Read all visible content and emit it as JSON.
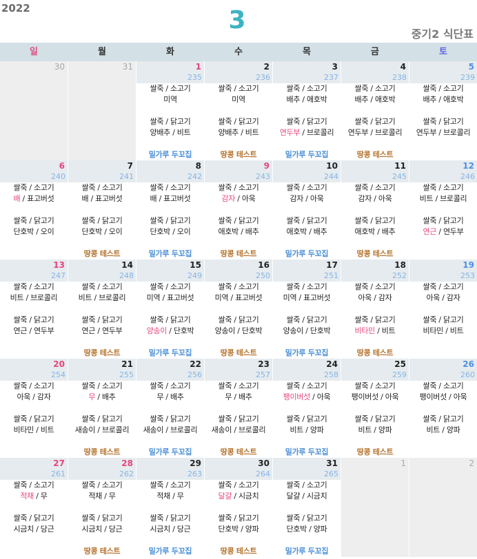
{
  "header": {
    "year": "2022",
    "month": "3",
    "title": "중기2 식단표"
  },
  "colors": {
    "month": "#3db3c4",
    "holiday": "#e8457d",
    "saturday_date": "#4f8fe3",
    "new_food": "#e8457d",
    "count": "#86b4e6",
    "muted_date": "#a8a8a8"
  },
  "weekdays": [
    {
      "label": "일",
      "color": "#e24a84"
    },
    {
      "label": "월"
    },
    {
      "label": "화"
    },
    {
      "label": "수"
    },
    {
      "label": "목"
    },
    {
      "label": "금"
    },
    {
      "label": "토",
      "color": "#6366e0"
    }
  ],
  "weeks": [
    [
      {
        "day": 30,
        "muted": true
      },
      {
        "day": 31,
        "muted": true
      },
      {
        "day": 1,
        "count": 235,
        "red": true,
        "meals": [
          [
            "쌀죽 / 소고기",
            "미역"
          ],
          [
            "쌀죽 / 닭고기",
            "양배추 / 비트"
          ]
        ],
        "note": {
          "text": "밀가루 두꼬집",
          "color": "#4a8fd6"
        }
      },
      {
        "day": 2,
        "count": 236,
        "meals": [
          [
            "쌀죽 / 소고기",
            "미역"
          ],
          [
            "쌀죽 / 닭고기",
            "양배추 / 비트"
          ]
        ],
        "note": {
          "text": "땅콩 테스트",
          "color": "#b5732e"
        }
      },
      {
        "day": 3,
        "count": 237,
        "meals": [
          [
            "쌀죽 / 소고기",
            "배추 / 애호박"
          ],
          [
            "쌀죽 / 닭고기",
            {
              "new": "연두부",
              "rest": " / 브로콜리"
            }
          ]
        ],
        "note": {
          "text": "밀가루 두꼬집",
          "color": "#4a8fd6"
        }
      },
      {
        "day": 4,
        "count": 238,
        "meals": [
          [
            "쌀죽 / 소고기",
            "배추 / 애호박"
          ],
          [
            "쌀죽 / 닭고기",
            "연두부 / 브로콜리"
          ]
        ],
        "note": {
          "text": "땅콩 테스트",
          "color": "#b5732e"
        }
      },
      {
        "day": 5,
        "count": 239,
        "meals": [
          [
            "쌀죽 / 소고기",
            "배추 / 애호박"
          ],
          [
            "쌀죽 / 닭고기",
            "연두부 / 브로콜리"
          ]
        ]
      }
    ],
    [
      {
        "day": 6,
        "count": 240,
        "meals": [
          [
            "쌀죽 / 소고기",
            {
              "new": "배",
              "rest": " / 표고버섯"
            }
          ],
          [
            "쌀죽 / 닭고기",
            "단호박 / 오이"
          ]
        ]
      },
      {
        "day": 7,
        "count": 241,
        "meals": [
          [
            "쌀죽 / 소고기",
            "배 / 표고버섯"
          ],
          [
            "쌀죽 / 닭고기",
            "단호박 / 오이"
          ]
        ],
        "note": {
          "text": "땅콩 테스트",
          "color": "#b5732e"
        }
      },
      {
        "day": 8,
        "count": 242,
        "meals": [
          [
            "쌀죽 / 소고기",
            "배 / 표고버섯"
          ],
          [
            "쌀죽 / 닭고기",
            "단호박 / 오이"
          ]
        ],
        "note": {
          "text": "밀가루 두꼬집",
          "color": "#4a8fd6"
        }
      },
      {
        "day": 9,
        "count": 243,
        "red": true,
        "meals": [
          [
            "쌀죽 / 소고기",
            {
              "new": "감자",
              "rest": " / 아욱"
            }
          ],
          [
            "쌀죽 / 닭고기",
            "애호박 / 배추"
          ]
        ],
        "note": {
          "text": "땅콩 테스트",
          "color": "#b5732e"
        }
      },
      {
        "day": 10,
        "count": 244,
        "meals": [
          [
            "쌀죽 / 소고기",
            "감자 / 아욱"
          ],
          [
            "쌀죽 / 닭고기",
            "애호박 / 배추"
          ]
        ],
        "note": {
          "text": "밀가루 두꼬집",
          "color": "#4a8fd6"
        }
      },
      {
        "day": 11,
        "count": 245,
        "meals": [
          [
            "쌀죽 / 소고기",
            "감자 / 아욱"
          ],
          [
            "쌀죽 / 닭고기",
            "애호박 / 배추"
          ]
        ],
        "note": {
          "text": "땅콩 테스트",
          "color": "#b5732e"
        }
      },
      {
        "day": 12,
        "count": 246,
        "meals": [
          [
            "쌀죽 / 소고기",
            "비트 / 브로콜리"
          ],
          [
            "쌀죽 / 닭고기",
            {
              "new": "연근",
              "rest": " / 연두부"
            }
          ]
        ]
      }
    ],
    [
      {
        "day": 13,
        "count": 247,
        "meals": [
          [
            "쌀죽 / 소고기",
            "비트 / 브로콜리"
          ],
          [
            "쌀죽 / 닭고기",
            "연근 / 연두부"
          ]
        ]
      },
      {
        "day": 14,
        "count": 248,
        "meals": [
          [
            "쌀죽 / 소고기",
            "비트 / 브로콜리"
          ],
          [
            "쌀죽 / 닭고기",
            "연근 / 연두부"
          ]
        ],
        "note": {
          "text": "땅콩 테스트",
          "color": "#b5732e"
        }
      },
      {
        "day": 15,
        "count": 249,
        "meals": [
          [
            "쌀죽 / 소고기",
            "미역 / 표고버섯"
          ],
          [
            "쌀죽 / 닭고기",
            {
              "new": "양송이",
              "rest": " / 단호박"
            }
          ]
        ],
        "note": {
          "text": "밀가루 두꼬집",
          "color": "#4a8fd6"
        }
      },
      {
        "day": 16,
        "count": 250,
        "meals": [
          [
            "쌀죽 / 소고기",
            "미역 / 표고버섯"
          ],
          [
            "쌀죽 / 닭고기",
            "양송이 / 단호박"
          ]
        ],
        "note": {
          "text": "땅콩 테스트",
          "color": "#b5732e"
        }
      },
      {
        "day": 17,
        "count": 251,
        "meals": [
          [
            "쌀죽 / 소고기",
            "미역 / 표고버섯"
          ],
          [
            "쌀죽 / 닭고기",
            "양송이 / 단호박"
          ]
        ],
        "note": {
          "text": "밀가루 두꼬집",
          "color": "#4a8fd6"
        }
      },
      {
        "day": 18,
        "count": 252,
        "meals": [
          [
            "쌀죽 / 소고기",
            "아욱 / 감자"
          ],
          [
            "쌀죽 / 닭고기",
            {
              "new": "비타민",
              "rest": " / 비트"
            }
          ]
        ],
        "note": {
          "text": "땅콩 테스트",
          "color": "#b5732e"
        }
      },
      {
        "day": 19,
        "count": 253,
        "meals": [
          [
            "쌀죽 / 소고기",
            "아욱 / 감자"
          ],
          [
            "쌀죽 / 닭고기",
            "비타민 / 비트"
          ]
        ]
      }
    ],
    [
      {
        "day": 20,
        "count": 254,
        "meals": [
          [
            "쌀죽 / 소고기",
            "아욱 / 감자"
          ],
          [
            "쌀죽 / 닭고기",
            "비타민 / 비트"
          ]
        ]
      },
      {
        "day": 21,
        "count": 255,
        "meals": [
          [
            "쌀죽 / 소고기",
            {
              "new": "무",
              "rest": " / 배추"
            }
          ],
          [
            "쌀죽 / 닭고기",
            "새송이 / 브로콜리"
          ]
        ],
        "note": {
          "text": "땅콩 테스트",
          "color": "#b5732e"
        }
      },
      {
        "day": 22,
        "count": 256,
        "meals": [
          [
            "쌀죽 / 소고기",
            "무 / 배추"
          ],
          [
            "쌀죽 / 닭고기",
            "새송이 / 브로콜리"
          ]
        ],
        "note": {
          "text": "밀가루 두꼬집",
          "color": "#4a8fd6"
        }
      },
      {
        "day": 23,
        "count": 257,
        "meals": [
          [
            "쌀죽 / 소고기",
            "무 / 배추"
          ],
          [
            "쌀죽 / 닭고기",
            "새송이 / 브로콜리"
          ]
        ],
        "note": {
          "text": "땅콩 테스트",
          "color": "#b5732e"
        }
      },
      {
        "day": 24,
        "count": 258,
        "meals": [
          [
            "쌀죽 / 소고기",
            {
              "new": "팽이버섯",
              "rest": " / 아욱"
            }
          ],
          [
            "쌀죽 / 닭고기",
            "비트 / 양파"
          ]
        ],
        "note": {
          "text": "밀가루 두꼬집",
          "color": "#4a8fd6"
        }
      },
      {
        "day": 25,
        "count": 259,
        "meals": [
          [
            "쌀죽 / 소고기",
            "팽이버섯 / 아욱"
          ],
          [
            "쌀죽 / 닭고기",
            "비트 / 양파"
          ]
        ],
        "note": {
          "text": "땅콩 테스트",
          "color": "#b5732e"
        }
      },
      {
        "day": 26,
        "count": 260,
        "meals": [
          [
            "쌀죽 / 소고기",
            "팽이버섯 / 아욱"
          ],
          [
            "쌀죽 / 닭고기",
            "비트 / 양파"
          ]
        ]
      }
    ],
    [
      {
        "day": 27,
        "count": 261,
        "meals": [
          [
            "쌀죽 / 소고기",
            {
              "new": "적채",
              "rest": " / 무"
            }
          ],
          [
            "쌀죽 / 닭고기",
            "시금치 / 당근"
          ]
        ]
      },
      {
        "day": 28,
        "count": 262,
        "red": true,
        "meals": [
          [
            "쌀죽 / 소고기",
            "적채 / 무"
          ],
          [
            "쌀죽 / 닭고기",
            "시금치 / 당근"
          ]
        ],
        "note": {
          "text": "땅콩 테스트",
          "color": "#b5732e"
        }
      },
      {
        "day": 29,
        "count": 263,
        "meals": [
          [
            "쌀죽 / 소고기",
            "적채 / 무"
          ],
          [
            "쌀죽 / 닭고기",
            "시금치 / 당근"
          ]
        ],
        "note": {
          "text": "밀가루 두꼬집",
          "color": "#4a8fd6"
        }
      },
      {
        "day": 30,
        "count": 264,
        "meals": [
          [
            "쌀죽 / 소고기",
            {
              "new": "달걀",
              "rest": " / 시금치"
            }
          ],
          [
            "쌀죽 / 닭고기",
            "단호박 / 양파"
          ]
        ],
        "note": {
          "text": "땅콩 테스트",
          "color": "#b5732e"
        }
      },
      {
        "day": 31,
        "count": 265,
        "meals": [
          [
            "쌀죽 / 소고기",
            "달걀 / 시금치"
          ],
          [
            "쌀죽 / 닭고기",
            "단호박 / 양파"
          ]
        ],
        "note": {
          "text": "밀가루 두꼬집",
          "color": "#4a8fd6"
        }
      },
      {
        "day": 1,
        "muted": true
      },
      {
        "day": 2,
        "muted": true
      }
    ]
  ]
}
